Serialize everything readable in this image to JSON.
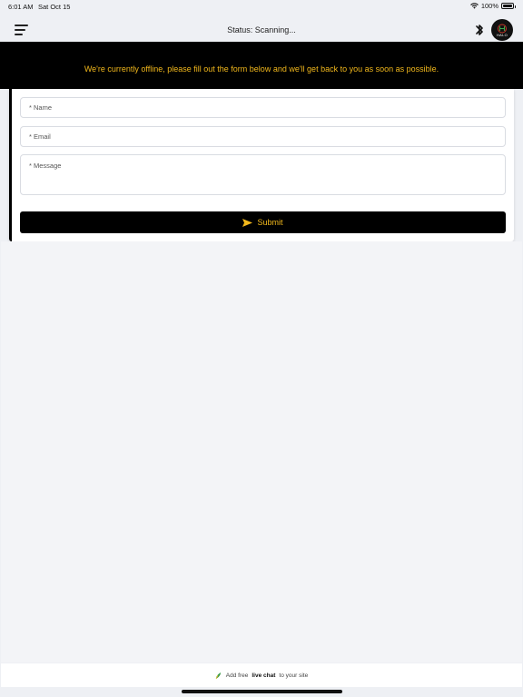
{
  "status_bar": {
    "time": "6:01 AM",
    "date": "Sat Oct 15",
    "battery": "100%"
  },
  "header": {
    "status": "Status: Scanning...",
    "logo_text": "HALO"
  },
  "banner": {
    "message": "We're currently offline, please fill out the form below and we'll get back to you as soon as possible."
  },
  "form": {
    "name_placeholder": "* Name",
    "email_placeholder": "* Email",
    "message_placeholder": "* Message",
    "submit_label": "Submit"
  },
  "footer": {
    "prefix": "Add free",
    "bold": "live chat",
    "suffix": "to your site"
  },
  "colors": {
    "accent": "#f2b81c",
    "banner_bg": "#000000",
    "page_bg": "#f3f4f7"
  },
  "icons": [
    "wifi-icon",
    "battery-icon",
    "menu-icon",
    "bluetooth-icon",
    "send-icon",
    "chat-logo-icon"
  ]
}
